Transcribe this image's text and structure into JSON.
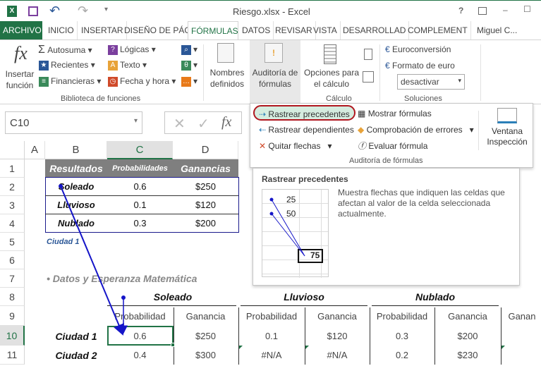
{
  "window": {
    "title": "Riesgo.xlsx - Excel",
    "help": "?",
    "minimize": "–",
    "maximize": "☐",
    "close": "✕"
  },
  "tabs": [
    {
      "label": "ARCHIVO"
    },
    {
      "label": "INICIO"
    },
    {
      "label": "INSERTAR"
    },
    {
      "label": "DISEÑO DE PÁG"
    },
    {
      "label": "FÓRMULAS"
    },
    {
      "label": "DATOS"
    },
    {
      "label": "REVISAR"
    },
    {
      "label": "VISTA"
    },
    {
      "label": "DESARROLLAD"
    },
    {
      "label": "COMPLEMENT"
    }
  ],
  "user": "Miguel C...",
  "ribbon": {
    "insert_function": "Insertar función",
    "autosum": "Autosuma",
    "recent": "Recientes",
    "financial": "Financieras",
    "logical": "Lógicas",
    "text": "Texto",
    "datetime": "Fecha y hora",
    "library_group": "Biblioteca de funciones",
    "defined_names": "Nombres definidos",
    "auditing": "Auditoría de fórmulas",
    "calc_options": "Opciones para el cálculo",
    "calc_group": "Cálculo",
    "euroconv": "Euroconversión",
    "euro_format": "Formato de euro",
    "euro_select": "desactivar",
    "solutions_group": "Soluciones"
  },
  "formula_bar": {
    "name_box": "C10",
    "fx": "fx",
    "cancel": "✕",
    "enter": "✓"
  },
  "columns": [
    "A",
    "B",
    "C",
    "D"
  ],
  "rows": [
    "1",
    "2",
    "3",
    "4",
    "5",
    "6",
    "7",
    "8",
    "9",
    "10",
    "11"
  ],
  "results_table": {
    "headers": [
      "Resultados",
      "Probabilidades",
      "Ganancias"
    ],
    "rows": [
      [
        "Soleado",
        "0.6",
        "$250"
      ],
      [
        "Lluvioso",
        "0.1",
        "$120"
      ],
      [
        "Nublado",
        "0.3",
        "$200"
      ]
    ]
  },
  "city_label": "Ciudad 1",
  "section_title": "• Datos y Esperanza Matemática",
  "data_table": {
    "groups": [
      "Soleado",
      "Lluvioso",
      "Nublado"
    ],
    "subheaders": [
      "Probabilidad",
      "Ganancia",
      "Probabilidad",
      "Ganancia",
      "Probabilidad",
      "Ganancia",
      "Ganan"
    ],
    "rows": [
      {
        "label": "Ciudad 1",
        "values": [
          "0.6",
          "$250",
          "0.1",
          "$120",
          "0.3",
          "$200"
        ]
      },
      {
        "label": "Ciudad 2",
        "values": [
          "0.4",
          "$300",
          "#N/A",
          "#N/A",
          "0.2",
          "$230"
        ]
      }
    ]
  },
  "dropdown": {
    "trace_precedents": "Rastrear precedentes",
    "trace_dependents": "Rastrear dependientes",
    "remove_arrows": "Quitar flechas",
    "show_formulas": "Mostrar fórmulas",
    "error_checking": "Comprobación de errores",
    "evaluate": "Evaluar fórmula",
    "watch_window": "Ventana Inspección",
    "group": "Auditoría de fórmulas"
  },
  "tooltip": {
    "title": "Rastrear precedentes",
    "description": "Muestra flechas que indiquen las celdas que afectan al valor de la celda seleccionada actualmente.",
    "sample_values": [
      "25",
      "50",
      "75"
    ]
  },
  "colors": {
    "accent": "#217346",
    "arrow": "#1515c8",
    "header_bg": "#7f7f7f",
    "highlight": "#c00000"
  }
}
